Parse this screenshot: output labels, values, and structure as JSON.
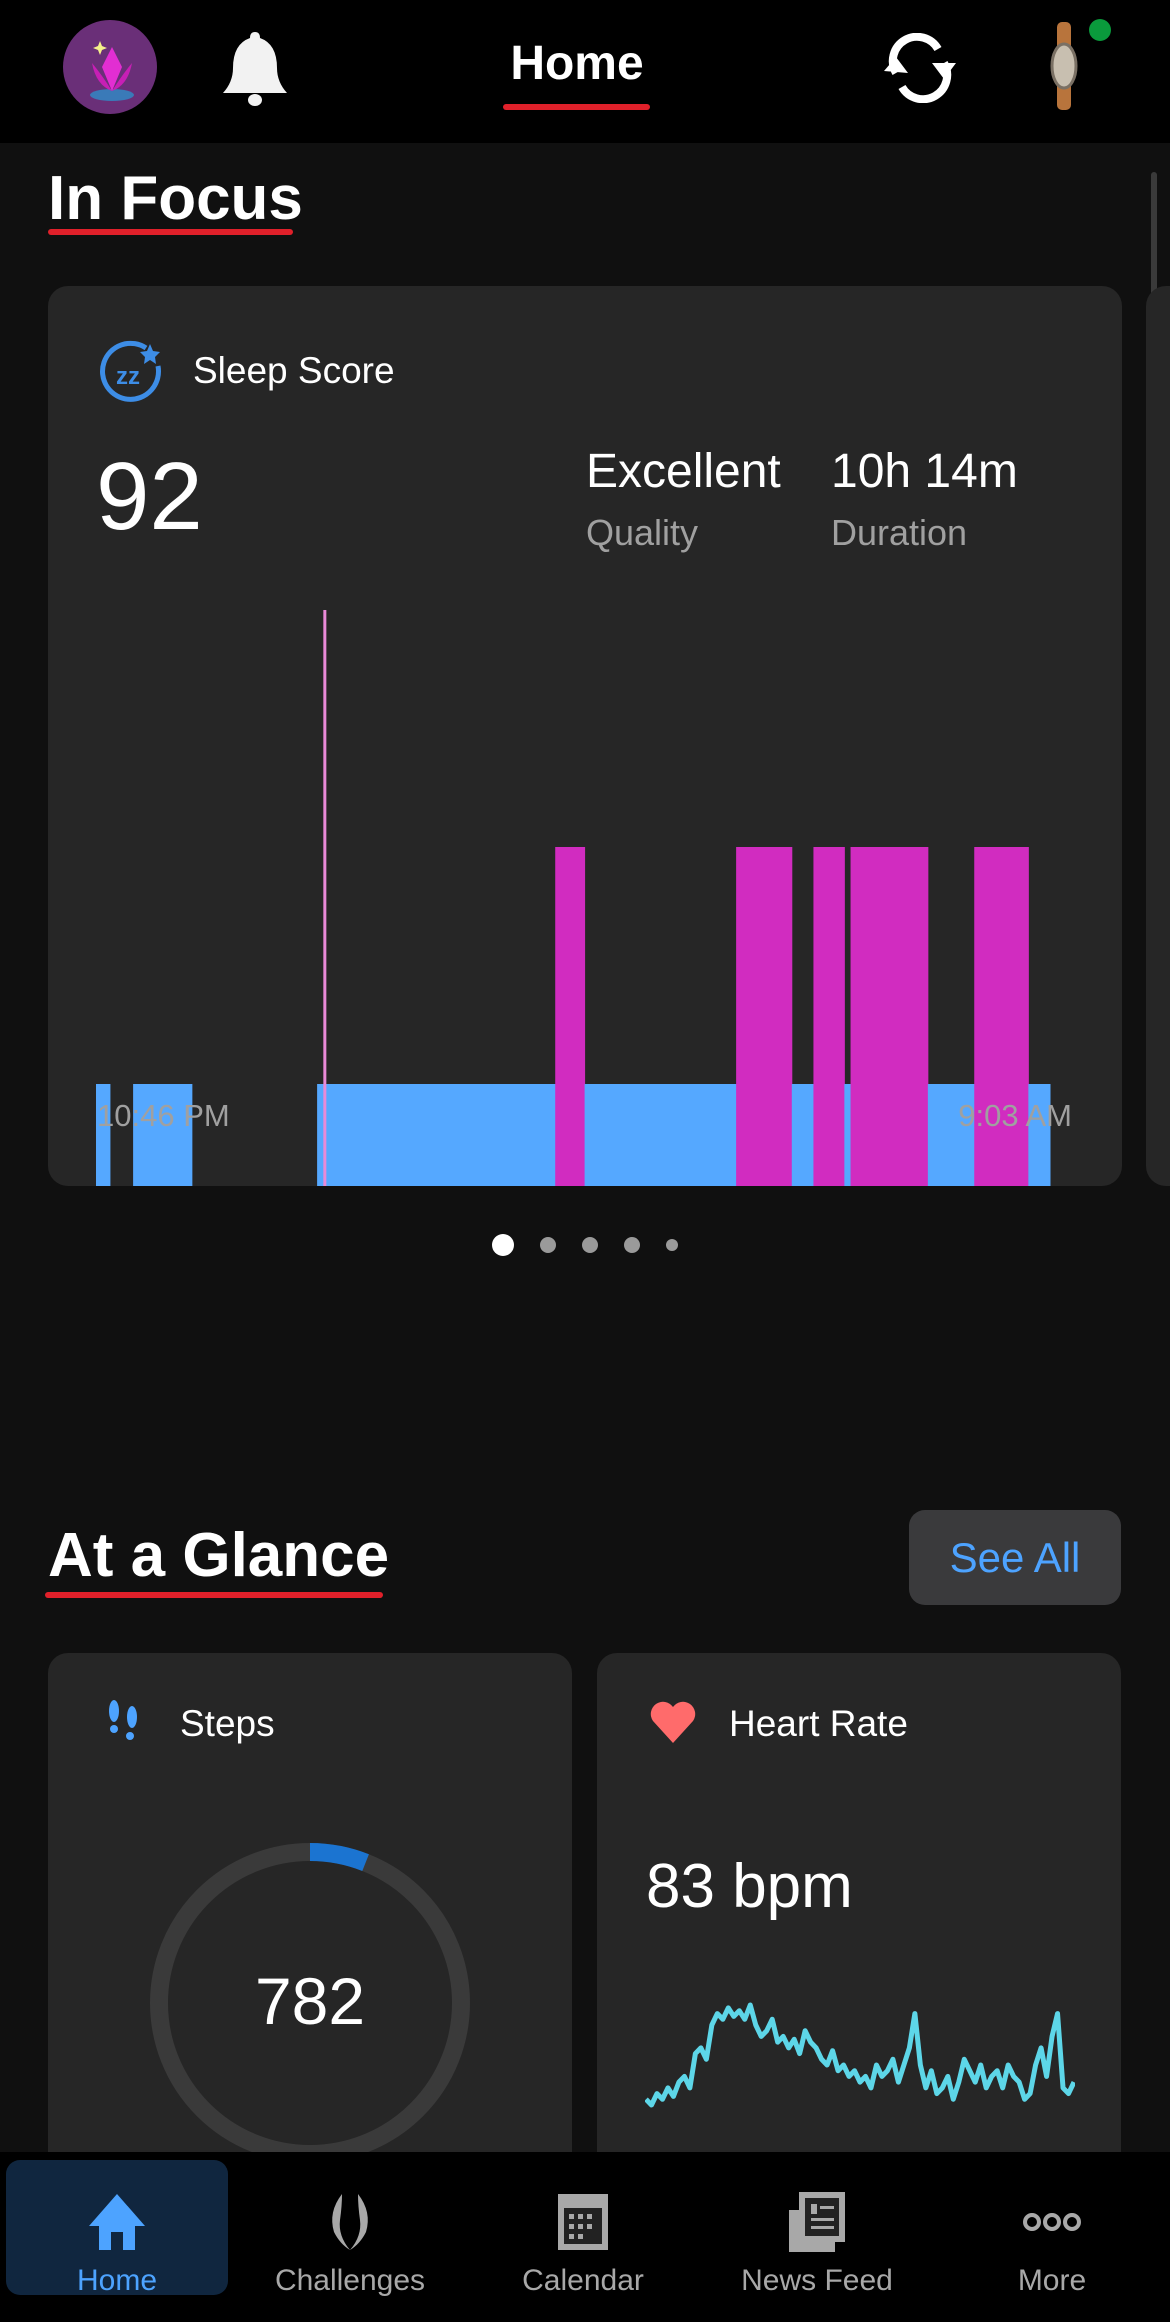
{
  "header": {
    "title": "Home",
    "icons": [
      "lotus-avatar-icon",
      "bell-icon",
      "sync-icon",
      "watch-device-icon"
    ],
    "device_status_color": "#0a9a3c",
    "accent_underline": "#e0202a"
  },
  "in_focus": {
    "title": "In Focus",
    "pager": {
      "count": 5,
      "active": 0
    }
  },
  "sleep_card": {
    "title": "Sleep Score",
    "icon": "sleep-zz-icon",
    "score": "92",
    "quality_value": "Excellent",
    "quality_label": "Quality",
    "duration_value": "10h 14m",
    "duration_label": "Duration",
    "start_label": "10:46 PM",
    "end_label": "9:03 AM"
  },
  "chart_data": {
    "type": "bar",
    "title": "",
    "x_range": [
      "10:46 PM",
      "9:03 AM"
    ],
    "stage_colors": {
      "deep": "#1b74d1",
      "light": "#55a8ff",
      "rem": "#d12cc0",
      "awake": "#e98ad8"
    },
    "segments": [
      {
        "stage": "light",
        "start": "10:46 PM",
        "end": "10:55 PM"
      },
      {
        "stage": "deep",
        "start": "10:55 PM",
        "end": "11:10 PM"
      },
      {
        "stage": "light",
        "start": "11:10 PM",
        "end": "11:48 PM"
      },
      {
        "stage": "deep",
        "start": "11:48 PM",
        "end": "1:09 AM"
      },
      {
        "stage": "light",
        "start": "1:09 AM",
        "end": "3:43 AM"
      },
      {
        "stage": "rem",
        "start": "3:43 AM",
        "end": "4:02 AM"
      },
      {
        "stage": "light",
        "start": "4:02 AM",
        "end": "5:40 AM"
      },
      {
        "stage": "rem",
        "start": "5:40 AM",
        "end": "6:16 AM"
      },
      {
        "stage": "light",
        "start": "6:16 AM",
        "end": "6:30 AM"
      },
      {
        "stage": "rem",
        "start": "6:30 AM",
        "end": "6:50 AM"
      },
      {
        "stage": "light",
        "start": "6:50 AM",
        "end": "6:54 AM"
      },
      {
        "stage": "rem",
        "start": "6:54 AM",
        "end": "7:44 AM"
      },
      {
        "stage": "light",
        "start": "7:44 AM",
        "end": "8:14 AM"
      },
      {
        "stage": "rem",
        "start": "8:14 AM",
        "end": "8:49 AM"
      },
      {
        "stage": "light",
        "start": "8:49 AM",
        "end": "9:03 AM"
      }
    ],
    "awake_marks": [
      "1:14 AM"
    ]
  },
  "at_a_glance": {
    "title": "At a Glance",
    "see_all": "See All"
  },
  "steps_card": {
    "title": "Steps",
    "icon": "footsteps-icon",
    "value": "782",
    "goal_progress": 0.06,
    "ring_color": "#1b74d1"
  },
  "heart_card": {
    "title": "Heart Rate",
    "icon": "heart-icon",
    "value": "83 bpm",
    "line_color": "#5dd6e8",
    "trend": [
      62,
      60,
      64,
      62,
      66,
      63,
      68,
      70,
      66,
      78,
      80,
      76,
      88,
      92,
      90,
      94,
      91,
      93,
      90,
      95,
      88,
      84,
      86,
      90,
      82,
      84,
      80,
      83,
      78,
      86,
      82,
      80,
      76,
      74,
      79,
      72,
      74,
      70,
      72,
      68,
      70,
      66,
      74,
      70,
      72,
      76,
      68,
      74,
      80,
      92,
      74,
      66,
      72,
      64,
      66,
      70,
      62,
      68,
      76,
      72,
      68,
      74,
      66,
      70,
      72,
      66,
      74,
      70,
      68,
      62,
      64,
      74,
      80,
      70,
      84,
      92,
      66,
      64,
      68
    ]
  },
  "nav": {
    "items": [
      {
        "label": "Home",
        "icon": "home-icon",
        "active": true
      },
      {
        "label": "Challenges",
        "icon": "laurel-icon"
      },
      {
        "label": "Calendar",
        "icon": "calendar-icon"
      },
      {
        "label": "News Feed",
        "icon": "newspaper-icon"
      },
      {
        "label": "More",
        "icon": "more-dots-icon"
      }
    ]
  }
}
